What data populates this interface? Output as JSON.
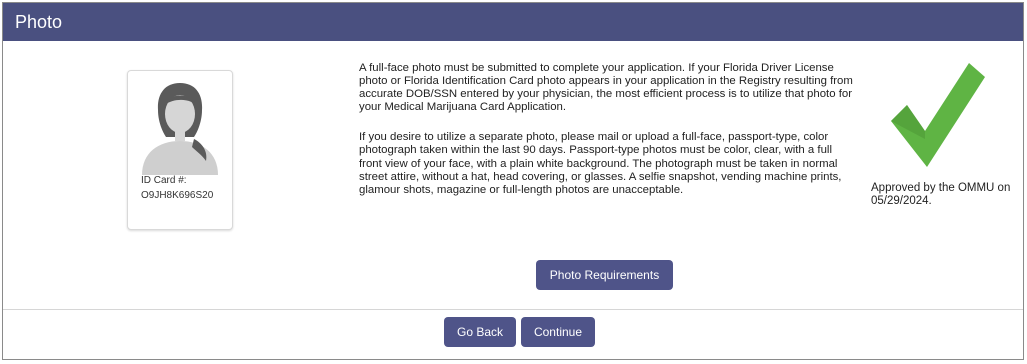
{
  "section": {
    "title": "Photo"
  },
  "id_card": {
    "label": "ID Card #:",
    "number": "O9JH8K696S20",
    "avatar_icon": "person-silhouette-icon"
  },
  "description": {
    "paragraph1": "A full-face photo must be submitted to complete your application. If your Florida Driver License photo or Florida Identification Card photo appears in your application in the Registry resulting from accurate DOB/SSN entered by your physician, the most efficient process is to utilize that photo for your Medical Marijuana Card Application.",
    "paragraph2": "If you desire to utilize a separate photo, please mail or upload a full-face, passport-type, color photograph taken within the last 90 days. Passport-type photos must be color, clear, with a full front view of your face, with a plain white background. The photograph must be taken in normal street attire, without a hat, head covering, or glasses. A selfie snapshot, vending machine prints, glamour shots, magazine or full-length photos are unacceptable."
  },
  "status": {
    "icon": "checkmark-icon",
    "text": "Approved by the OMMU on 05/29/2024."
  },
  "buttons": {
    "photo_requirements": "Photo Requirements",
    "go_back": "Go Back",
    "continue": "Continue"
  },
  "colors": {
    "header_bg": "#4a5080",
    "button_bg": "#4f5489",
    "check_green": "#5fb444"
  }
}
